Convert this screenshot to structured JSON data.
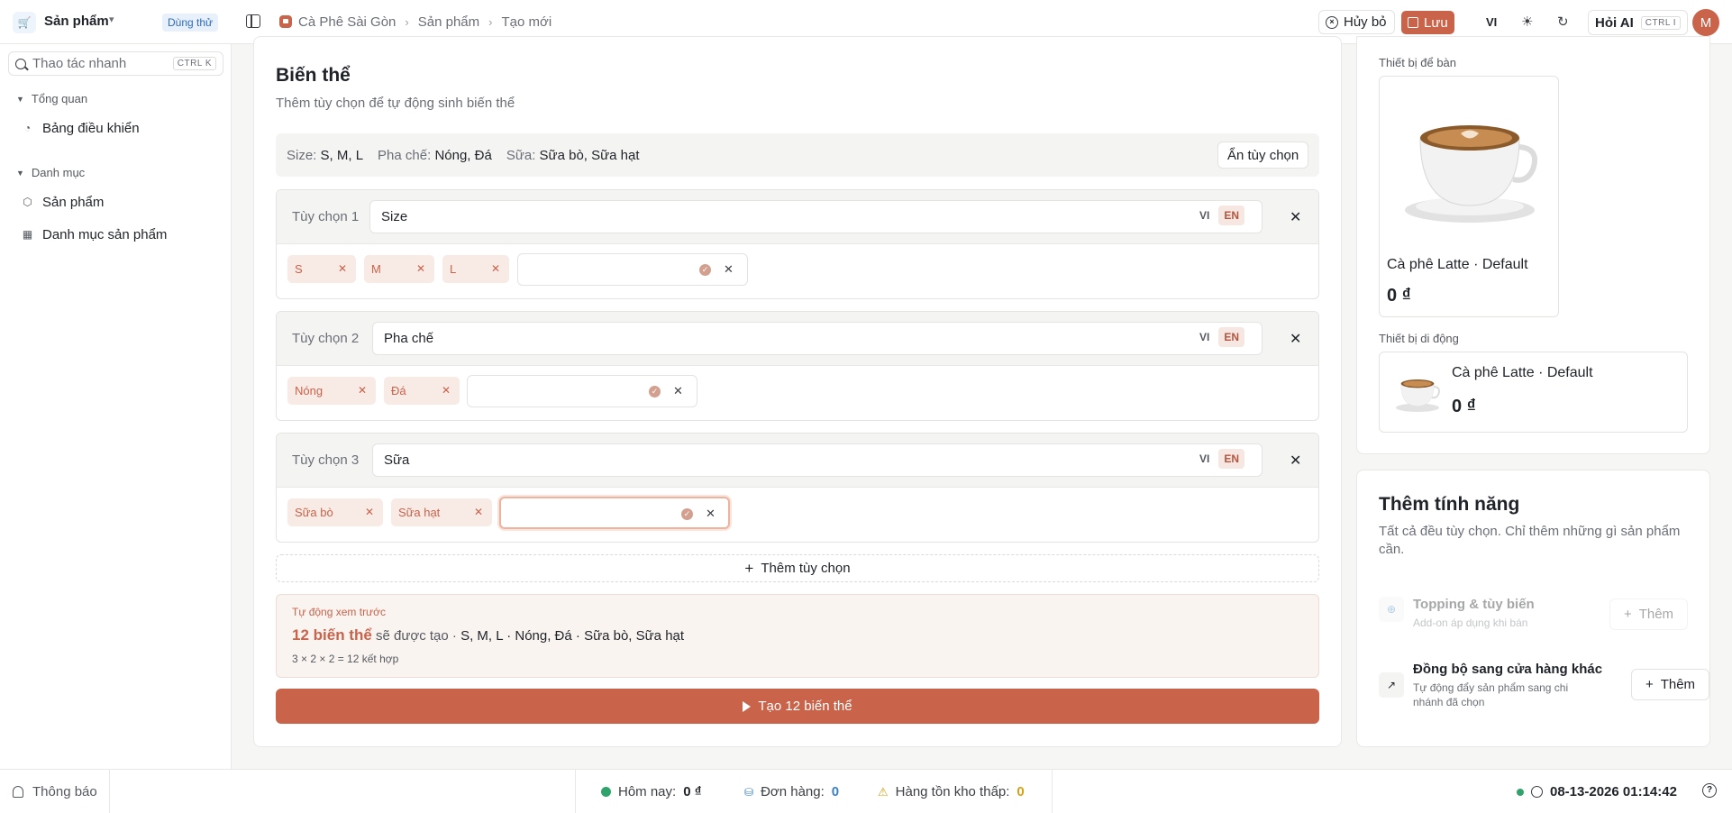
{
  "header": {
    "app_name": "Sản phẩm",
    "trial_badge": "Dùng thử",
    "breadcrumb": [
      "Cà Phê Sài Gòn",
      "Sản phẩm",
      "Tạo mới"
    ],
    "cancel_label": "Hủy bỏ",
    "save_label": "Lưu",
    "language": "VI",
    "ask_ai_label": "Hỏi AI",
    "ask_ai_shortcut": "CTRL I",
    "avatar_initial": "M",
    "accent_color": "#c9634a"
  },
  "sidebar": {
    "quick_action_label": "Thao tác nhanh",
    "quick_action_shortcut": "CTRL K",
    "sections": [
      {
        "title": "Tổng quan",
        "items": [
          {
            "label": "Bảng điều khiển",
            "icon": "dashboard-icon"
          }
        ]
      },
      {
        "title": "Danh mục",
        "items": [
          {
            "label": "Sản phẩm",
            "icon": "box-icon"
          },
          {
            "label": "Danh mục sản phẩm",
            "icon": "grid-icon"
          }
        ]
      }
    ]
  },
  "variants": {
    "title": "Biến thể",
    "subtitle": "Thêm tùy chọn để tự động sinh biến thể",
    "summary": [
      {
        "key": "Size:",
        "value": "S, M, L"
      },
      {
        "key": "Pha chế:",
        "value": "Nóng, Đá"
      },
      {
        "key": "Sữa:",
        "value": "Sữa bò, Sữa hạt"
      }
    ],
    "hide_options_label": "Ẩn tùy chọn",
    "lang_vi": "VI",
    "lang_en": "EN",
    "options": [
      {
        "label": "Tùy chọn 1",
        "name": "Size",
        "values": [
          "S",
          "M",
          "L"
        ]
      },
      {
        "label": "Tùy chọn 2",
        "name": "Pha chế",
        "values": [
          "Nóng",
          "Đá"
        ]
      },
      {
        "label": "Tùy chọn 3",
        "name": "Sữa",
        "values": [
          "Sữa bò",
          "Sữa hạt"
        ]
      }
    ],
    "add_option_label": "Thêm tùy chọn",
    "preview": {
      "label": "Tự động xem trước",
      "count_text": "12 biến thể",
      "will_create": "sẽ được tạo ·",
      "combos": "S, M, L · Nóng, Đá · Sữa bò, Sữa hạt",
      "formula": "3 × 2 × 2 = 12 kết hợp"
    },
    "generate_label": "Tạo 12 biến thể"
  },
  "preview_panel": {
    "desktop_label": "Thiết bị để bàn",
    "mobile_label": "Thiết bị di động",
    "product_name": "Cà phê Latte · Default",
    "price": "0 ₫"
  },
  "features": {
    "title": "Thêm tính năng",
    "subtitle": "Tất cả đều tùy chọn. Chỉ thêm những gì sản phẩm cần.",
    "items": [
      {
        "title": "Topping & tùy biến",
        "desc": "Add-on áp dụng khi bán",
        "button": "Thêm",
        "disabled": true
      },
      {
        "title": "Đồng bộ sang cửa hàng khác",
        "desc": "Tự động đẩy sản phẩm sang chi nhánh đã chọn",
        "button": "Thêm",
        "disabled": false
      }
    ]
  },
  "footer": {
    "notifications_label": "Thông báo",
    "today_label": "Hôm nay:",
    "today_value": "0 ₫",
    "orders_label": "Đơn hàng:",
    "orders_value": "0",
    "low_stock_label": "Hàng tồn kho thấp:",
    "low_stock_value": "0",
    "datetime": "08-13-2026 01:14:42"
  }
}
